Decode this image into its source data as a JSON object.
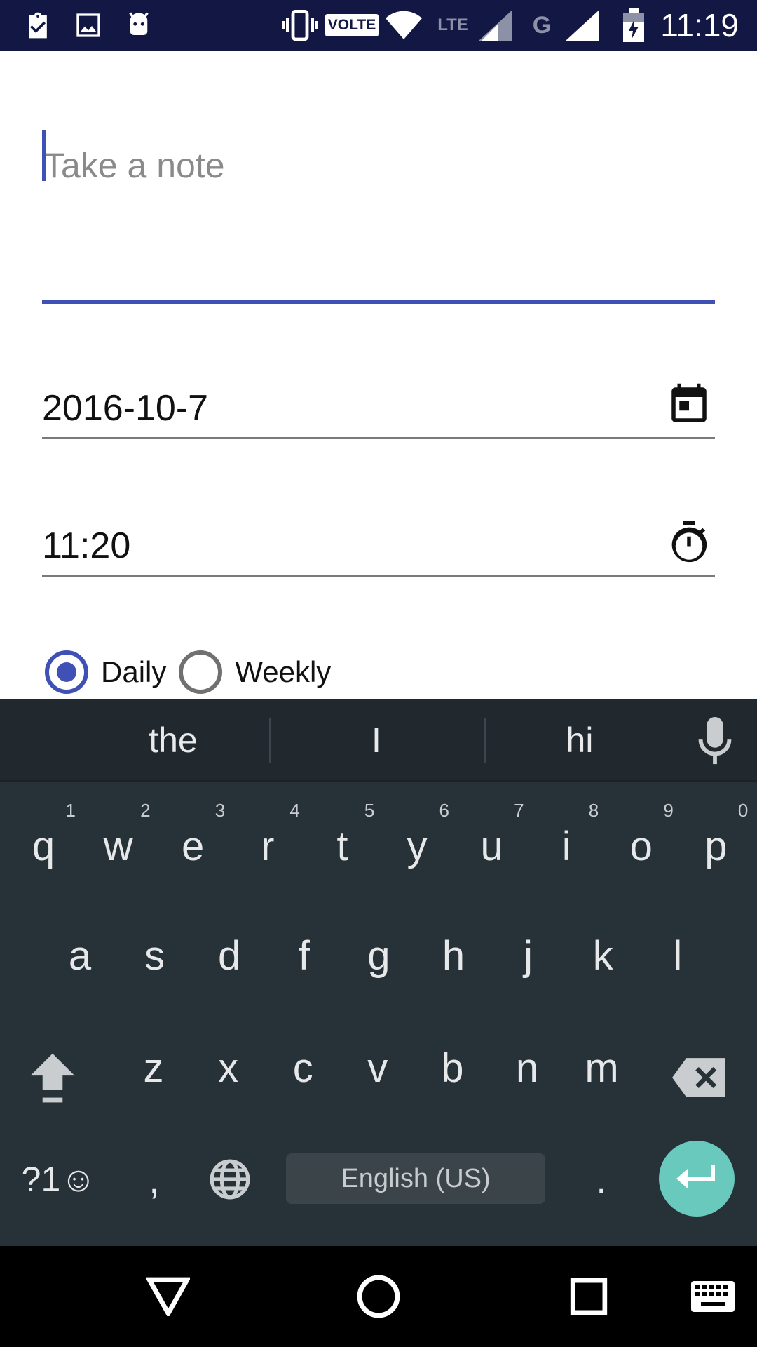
{
  "status_bar": {
    "time": "11:19",
    "left_icons": [
      "clipboard-check-icon",
      "image-icon",
      "android-icon"
    ],
    "right_icons": [
      "vibrate-icon",
      "volte-icon",
      "wifi-icon",
      "lte-icon",
      "signal-icon",
      "signal-g-icon",
      "battery-charging-icon"
    ],
    "volte_label": "VOLTE",
    "lte_label": "LTE",
    "g_label": "G"
  },
  "form": {
    "note_placeholder": "Take a note",
    "date_value": "2016-10-7",
    "time_value": "11:20",
    "repeat_options": [
      {
        "label": "Daily",
        "checked": true
      },
      {
        "label": "Weekly",
        "checked": false
      }
    ],
    "accent_color": "#3f51b5"
  },
  "keyboard": {
    "suggestions": [
      "the",
      "I",
      "hi"
    ],
    "row1": [
      "q",
      "w",
      "e",
      "r",
      "t",
      "y",
      "u",
      "i",
      "o",
      "p"
    ],
    "row1_hints": [
      "1",
      "2",
      "3",
      "4",
      "5",
      "6",
      "7",
      "8",
      "9",
      "0"
    ],
    "row2": [
      "a",
      "s",
      "d",
      "f",
      "g",
      "h",
      "j",
      "k",
      "l"
    ],
    "row3": [
      "z",
      "x",
      "c",
      "v",
      "b",
      "n",
      "m"
    ],
    "symbols_label": "?1☺",
    "comma_label": ",",
    "period_label": ".",
    "space_label": "English (US)",
    "enter_color": "#69c9bd"
  },
  "nav_bar": {
    "buttons": [
      "back-icon",
      "home-icon",
      "recents-icon",
      "keyboard-icon"
    ]
  }
}
